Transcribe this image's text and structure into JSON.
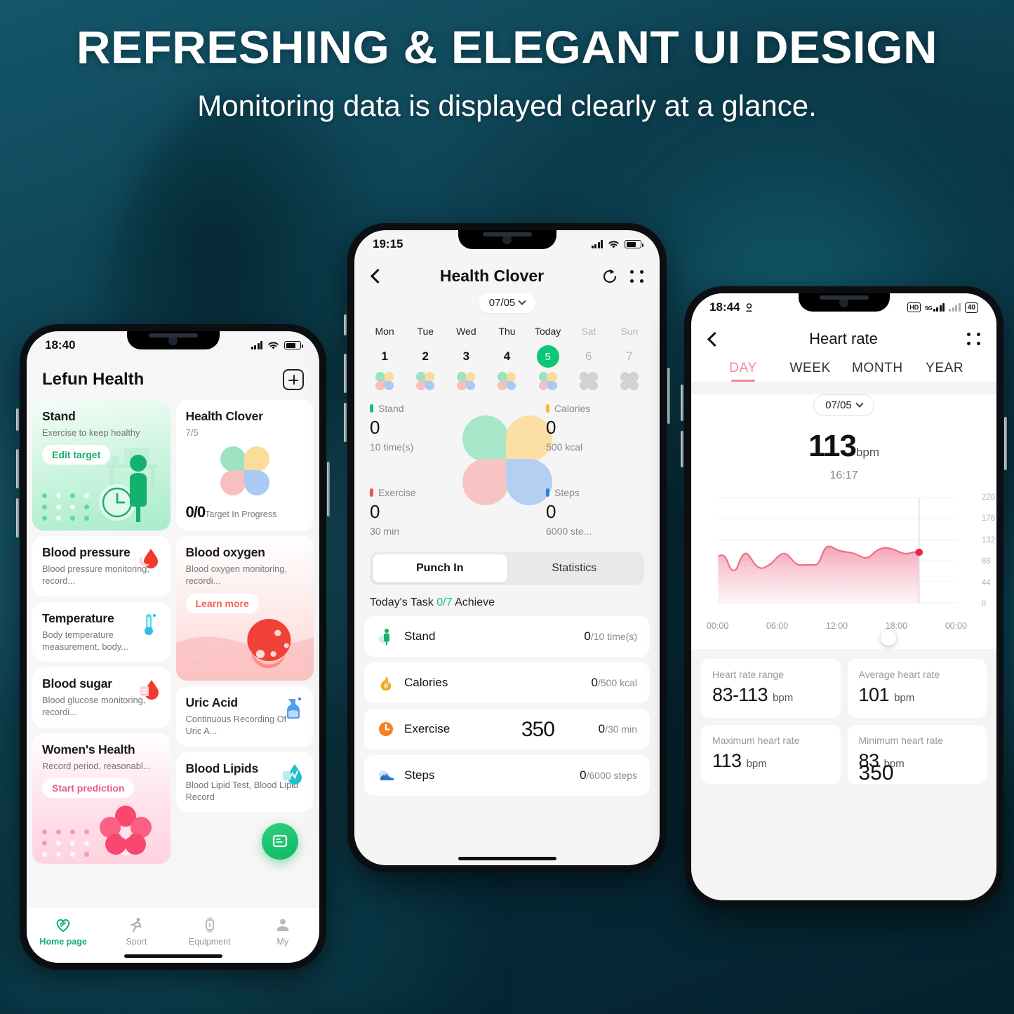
{
  "banner": {
    "headline": "REFRESHING & ELEGANT UI DESIGN",
    "subhead": "Monitoring data is displayed clearly at a glance."
  },
  "phone_left": {
    "status": {
      "time": "18:40",
      "battery_icon": "battery-icon",
      "wifi_icon": "wifi-icon",
      "signal_icon": "signal-icon"
    },
    "header": {
      "title": "Lefun Health",
      "add_button": "add-icon"
    },
    "tiles": {
      "stand": {
        "title": "Stand",
        "desc": "Exercise to keep healthy",
        "action": "Edit target"
      },
      "clover": {
        "title": "Health Clover",
        "sub": "7/5",
        "value": "0/0",
        "footer": "Target In Progress"
      },
      "blood_pressure": {
        "title": "Blood pressure",
        "desc": "Blood pressure monitoring, record..."
      },
      "temperature": {
        "title": "Temperature",
        "desc": "Body temperature measurement, body..."
      },
      "blood_sugar": {
        "title": "Blood sugar",
        "desc": "Blood glucose monitoring, recordi..."
      },
      "womens_health": {
        "title": "Women's Health",
        "desc": "Record period, reasonabl...",
        "action": "Start prediction"
      },
      "blood_oxygen": {
        "title": "Blood oxygen",
        "desc": "Blood oxygen monitoring, recordi...",
        "action": "Learn more"
      },
      "uric_acid": {
        "title": "Uric Acid",
        "desc": "Continuous Recording Of Uric A..."
      },
      "blood_lipids": {
        "title": "Blood Lipids",
        "desc": "Blood Lipid Test, Blood Lipid Record"
      }
    },
    "fab": "message-icon",
    "tabs": [
      {
        "label": "Home page",
        "icon": "heart-leaf-icon",
        "active": true
      },
      {
        "label": "Sport",
        "icon": "running-icon",
        "active": false
      },
      {
        "label": "Equipment",
        "icon": "watch-icon",
        "active": false
      },
      {
        "label": "My",
        "icon": "person-icon",
        "active": false
      }
    ]
  },
  "phone_center": {
    "status": {
      "time": "19:15"
    },
    "nav": {
      "back": "chevron-left-icon",
      "title": "Health Clover",
      "refresh": "refresh-icon",
      "more": "more-grid-icon"
    },
    "date_pill": "07/05",
    "week": [
      {
        "name": "Mon",
        "num": "1",
        "dim": false,
        "today": false
      },
      {
        "name": "Tue",
        "num": "2",
        "dim": false,
        "today": false
      },
      {
        "name": "Wed",
        "num": "3",
        "dim": false,
        "today": false
      },
      {
        "name": "Thu",
        "num": "4",
        "dim": false,
        "today": false
      },
      {
        "name": "Today",
        "num": "5",
        "dim": false,
        "today": true
      },
      {
        "name": "Sat",
        "num": "6",
        "dim": true,
        "today": false
      },
      {
        "name": "Sun",
        "num": "7",
        "dim": true,
        "today": false
      }
    ],
    "stats": {
      "stand": {
        "label": "Stand",
        "value": "0",
        "goal": "10 time(s)",
        "color": "#0ec774"
      },
      "calories": {
        "label": "Calories",
        "value": "0",
        "goal": "500 kcal",
        "color": "#f5b83d"
      },
      "exercise": {
        "label": "Exercise",
        "value": "0",
        "goal": "30 min",
        "color": "#ef5350"
      },
      "steps": {
        "label": "Steps",
        "value": "0",
        "goal": "6000 ste...",
        "color": "#2f7ce0"
      }
    },
    "segments": [
      {
        "label": "Punch In",
        "on": true
      },
      {
        "label": "Statistics",
        "on": false
      }
    ],
    "task_head": {
      "prefix": "Today's Task ",
      "fraction": "0/7",
      "suffix": " Achieve"
    },
    "tasks": [
      {
        "icon": "stand-person-icon",
        "label": "Stand",
        "done": "0",
        "goal": "/10 time(s)"
      },
      {
        "icon": "flame-icon",
        "label": "Calories",
        "done": "0",
        "goal": "/500 kcal"
      },
      {
        "icon": "clock-icon",
        "label": "Exercise",
        "done": "0",
        "goal": "/30 min",
        "overlay": "350"
      },
      {
        "icon": "shoe-icon",
        "label": "Steps",
        "done": "0",
        "goal": "/6000 steps"
      }
    ]
  },
  "phone_right": {
    "status": {
      "time": "18:44",
      "hd": "HD",
      "net": "5G",
      "battery": "40"
    },
    "nav": {
      "back": "chevron-left-icon",
      "title": "Heart rate",
      "more": "more-grid-icon"
    },
    "tabs": [
      {
        "label": "DAY",
        "on": true
      },
      {
        "label": "WEEK",
        "on": false
      },
      {
        "label": "MONTH",
        "on": false
      },
      {
        "label": "YEAR",
        "on": false
      }
    ],
    "date_pill": "07/05",
    "reading": {
      "value": "113",
      "unit": "bpm",
      "time": "16:17"
    },
    "cards": [
      {
        "title": "Heart rate range",
        "value": "83-113",
        "unit": "bpm"
      },
      {
        "title": "Average heart rate",
        "value": "101",
        "unit": "bpm"
      },
      {
        "title": "Maximum heart rate",
        "value": "113",
        "unit": "bpm"
      },
      {
        "title": "Minimum heart rate",
        "value": "83",
        "unit": "bpm",
        "overlay": "350"
      }
    ],
    "chart_data": {
      "type": "area",
      "title": "Heart rate",
      "xlabel": "",
      "ylabel": "bpm",
      "ylim": [
        0,
        220
      ],
      "yticks": [
        0,
        44,
        88,
        132,
        176,
        220
      ],
      "xticks": [
        "00:00",
        "06:00",
        "12:00",
        "18:00",
        "00:00"
      ],
      "grid": true,
      "legend": "none",
      "line_color": "#f26d8a",
      "fill_color": "#f9b4c2",
      "marker": {
        "x": "16:17",
        "y": 113,
        "color": "#e8274b"
      },
      "x": [
        "00:00",
        "01:00",
        "02:00",
        "03:00",
        "04:00",
        "05:00",
        "06:00",
        "07:00",
        "08:00",
        "09:00",
        "10:00",
        "11:00",
        "12:00",
        "13:00",
        "14:00",
        "15:00",
        "16:00",
        "16:17"
      ],
      "values": [
        101,
        86,
        103,
        92,
        90,
        88,
        92,
        99,
        90,
        90,
        105,
        101,
        100,
        96,
        98,
        104,
        101,
        113
      ]
    }
  }
}
